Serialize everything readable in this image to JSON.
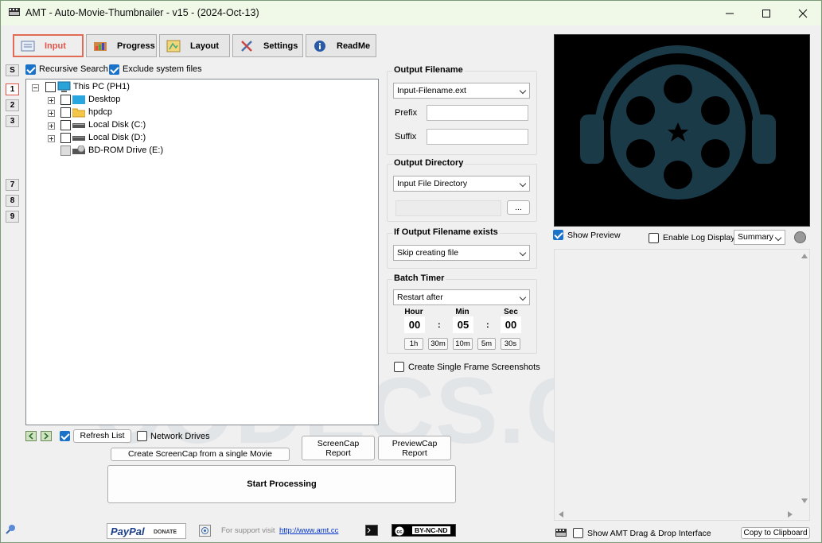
{
  "window": {
    "title": "AMT - Auto-Movie-Thumbnailer - v15 - (2024-Oct-13)",
    "controls": [
      "minimize",
      "maximize",
      "close"
    ]
  },
  "tabs": [
    {
      "label": "Input",
      "icon": "input-icon",
      "active": true
    },
    {
      "label": "Progress",
      "icon": "progress-icon",
      "active": false
    },
    {
      "label": "Layout",
      "icon": "layout-icon",
      "active": false
    },
    {
      "label": "Settings",
      "icon": "settings-icon",
      "active": false
    },
    {
      "label": "ReadMe",
      "icon": "info-icon",
      "active": false
    }
  ],
  "side_buttons": [
    "S",
    "1",
    "2",
    "3",
    "7",
    "8",
    "9"
  ],
  "options": {
    "recursive_search": {
      "label": "Recursive Search",
      "checked": true
    },
    "exclude_system": {
      "label": "Exclude system files",
      "checked": true
    }
  },
  "tree": [
    {
      "label": "This PC (PH1)",
      "icon": "computer-icon"
    },
    {
      "label": "Desktop",
      "icon": "desktop-folder-icon"
    },
    {
      "label": "hpdcp",
      "icon": "folder-icon"
    },
    {
      "label": "Local Disk (C:)",
      "icon": "drive-icon"
    },
    {
      "label": "Local Disk (D:)",
      "icon": "drive-icon"
    },
    {
      "label": "BD-ROM Drive (E:)",
      "icon": "optical-drive-icon"
    }
  ],
  "output_filename": {
    "title": "Output Filename",
    "select_value": "Input-Filename.ext",
    "prefix_label": "Prefix",
    "prefix_value": "",
    "suffix_label": "Suffix",
    "suffix_value": ""
  },
  "output_directory": {
    "title": "Output Directory",
    "select_value": "Input File Directory",
    "path_value": "",
    "browse_label": "..."
  },
  "if_exists": {
    "title": "If Output Filename exists",
    "select_value": "Skip creating file"
  },
  "batch_timer": {
    "title": "Batch Timer",
    "select_value": "Restart after",
    "hour_label": "Hour",
    "min_label": "Min",
    "sec_label": "Sec",
    "hour": "00",
    "min": "05",
    "sec": "00",
    "sep": ":",
    "presets": [
      "1h",
      "30m",
      "10m",
      "5m",
      "30s"
    ]
  },
  "single_frame": {
    "label": "Create Single Frame Screenshots",
    "checked": false
  },
  "bottom_left": {
    "refresh_label": "Refresh List",
    "network_drives_label": "Network Drives",
    "network_checked": false,
    "refresh_checked": true,
    "screencap_single_label": "Create ScreenCap from a single Movie",
    "screencap_report_label": "ScreenCap\nReport",
    "previewcap_report_label": "PreviewCap\nReport",
    "start_label": "Start Processing"
  },
  "footer": {
    "paypal_label": "PayPal",
    "donate_label": "DONATE",
    "support_text": "For support visit",
    "support_link": "http://www.amt.cc",
    "license_label": "BY-NC-ND"
  },
  "preview_panel": {
    "show_preview_label": "Show Preview",
    "show_preview_checked": true,
    "enable_log_label": "Enable Log Display",
    "enable_log_checked": false,
    "log_mode": "Summary",
    "show_dragdrop_label": "Show AMT Drag & Drop Interface",
    "dragdrop_checked": false,
    "copy_label": "Copy to Clipboard"
  },
  "watermark": "CODECS.COM",
  "colors": {
    "accent": "#1a73c8",
    "active_tab": "#e0544a",
    "titlebar": "#f0f8e8",
    "preview_bg": "#000000",
    "logo_color": "#1b3a48"
  }
}
